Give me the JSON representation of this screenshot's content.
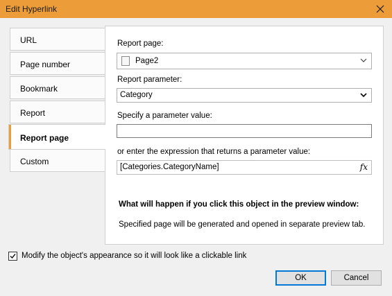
{
  "window": {
    "title": "Edit Hyperlink"
  },
  "tabs": [
    {
      "label": "URL"
    },
    {
      "label": "Page number"
    },
    {
      "label": "Bookmark"
    },
    {
      "label": "Report"
    },
    {
      "label": "Report page"
    },
    {
      "label": "Custom"
    }
  ],
  "active_tab": "Report page",
  "form": {
    "report_page_label": "Report page:",
    "report_page_value": "Page2",
    "report_param_label": "Report parameter:",
    "report_param_value": "Category",
    "param_value_label": "Specify a parameter value:",
    "param_value": "",
    "expression_label": "or enter the expression that returns a parameter value:",
    "expression_value": "[Categories.CategoryName]",
    "expression_button": "fx"
  },
  "info": {
    "title": "What will happen if you click this object in the preview window:",
    "text": "Specified page will be generated and opened in separate preview tab."
  },
  "options": {
    "modify_appearance_label": "Modify the object's appearance so it will look like a clickable link",
    "modify_appearance_checked": true
  },
  "buttons": {
    "ok": "OK",
    "cancel": "Cancel"
  },
  "colors": {
    "accent": "#ec9d3a",
    "focus_border": "#0078d7"
  }
}
